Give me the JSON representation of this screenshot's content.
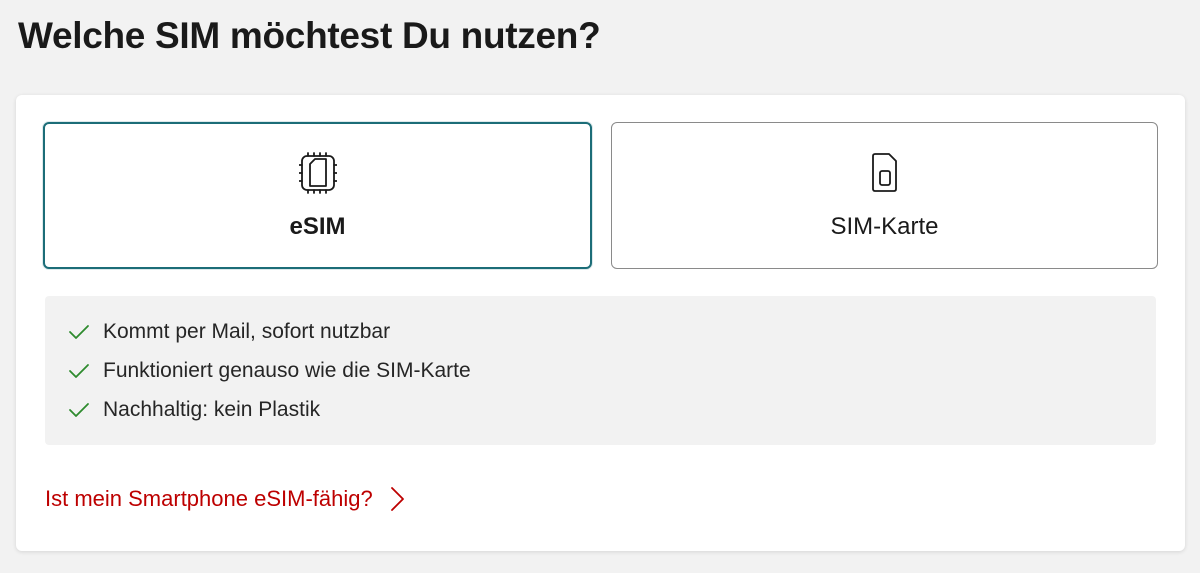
{
  "page": {
    "title": "Welche SIM möchtest Du nutzen?"
  },
  "options": [
    {
      "label": "eSIM",
      "icon": "esim-chip-icon",
      "selected": true
    },
    {
      "label": "SIM-Karte",
      "icon": "sim-card-icon",
      "selected": false
    }
  ],
  "benefits": [
    {
      "icon": "check-icon",
      "text": "Kommt per Mail, sofort nutzbar"
    },
    {
      "icon": "check-icon",
      "text": "Funktioniert genauso wie die SIM-Karte"
    },
    {
      "icon": "check-icon",
      "text": "Nachhaltig: kein Plastik"
    }
  ],
  "help_link": {
    "label": "Ist mein Smartphone eSIM-fähig?",
    "icon": "chevron-right-icon"
  },
  "colors": {
    "selected_border": "#1c6d78",
    "check": "#2e8b2e",
    "link": "#bd0000"
  }
}
